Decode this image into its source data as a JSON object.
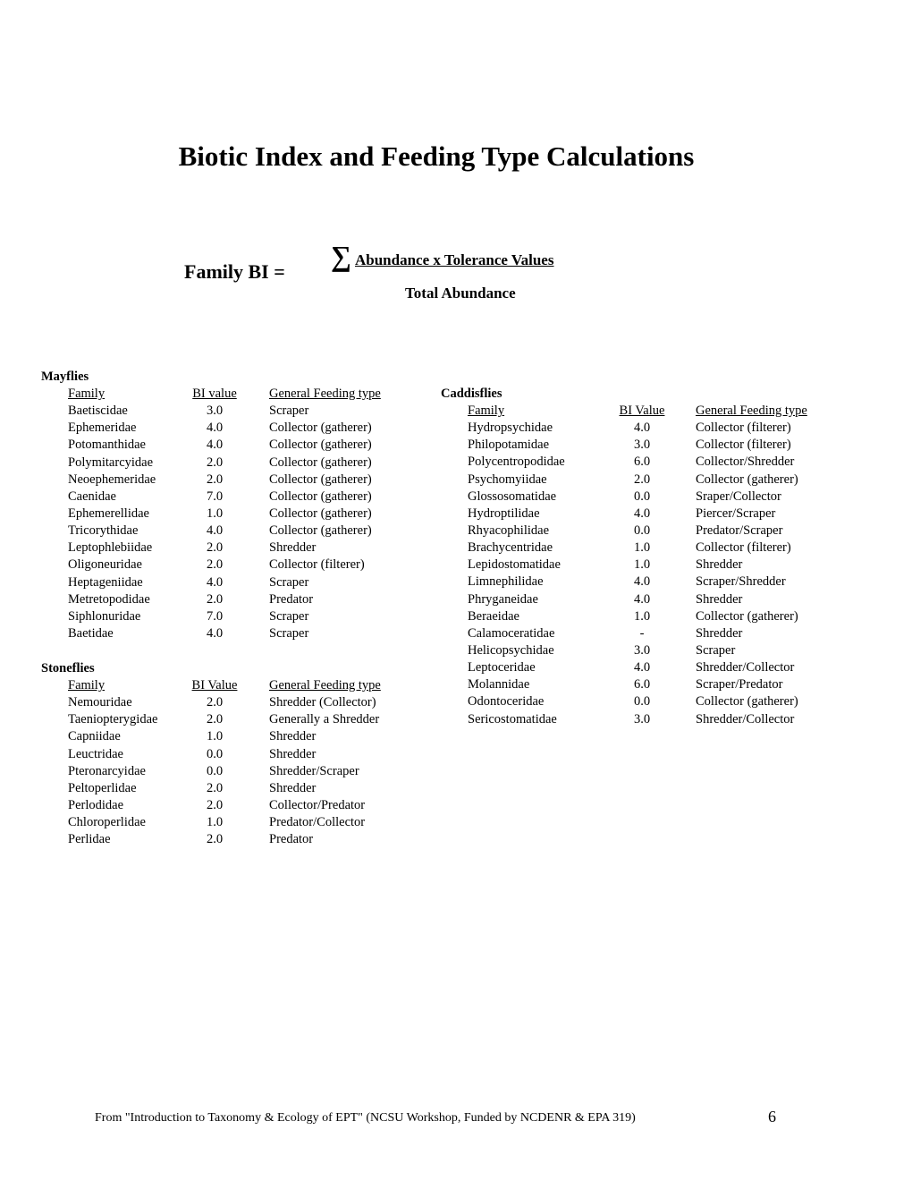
{
  "title": "Biotic Index and Feeding Type Calculations",
  "formula": {
    "label": "Family BI =",
    "sigma_icon": "∑",
    "numerator": "Abundance x Tolerance Values",
    "denominator": "Total Abundance"
  },
  "mayflies": {
    "heading": "Mayflies",
    "columns": [
      "Family",
      "BI value",
      "General Feeding type"
    ],
    "rows": [
      [
        "Baetiscidae",
        "3.0",
        "Scraper"
      ],
      [
        "Ephemeridae",
        "4.0",
        "Collector (gatherer)"
      ],
      [
        "Potomanthidae",
        "4.0",
        "Collector (gatherer)"
      ],
      [
        "Polymitarcyidae",
        "2.0",
        "Collector (gatherer)"
      ],
      [
        "Neoephemeridae",
        "2.0",
        "Collector (gatherer)"
      ],
      [
        "Caenidae",
        "7.0",
        "Collector (gatherer)"
      ],
      [
        "Ephemerellidae",
        "1.0",
        "Collector (gatherer)"
      ],
      [
        "Tricorythidae",
        "4.0",
        "Collector (gatherer)"
      ],
      [
        "Leptophlebiidae",
        "2.0",
        "Shredder"
      ],
      [
        "Oligoneuridae",
        "2.0",
        "Collector (filterer)"
      ],
      [
        "Heptageniidae",
        "4.0",
        "Scraper"
      ],
      [
        "Metretopodidae",
        "2.0",
        "Predator"
      ],
      [
        "Siphlonuridae",
        "7.0",
        "Scraper"
      ],
      [
        "Baetidae",
        "4.0",
        "Scraper"
      ]
    ]
  },
  "stoneflies": {
    "heading": "Stoneflies",
    "columns": [
      "Family",
      "BI Value",
      "General Feeding type"
    ],
    "rows": [
      [
        "Nemouridae",
        "2.0",
        "Shredder (Collector)"
      ],
      [
        "Taeniopterygidae",
        "2.0",
        "Generally a Shredder"
      ],
      [
        "Capniidae",
        "1.0",
        "Shredder"
      ],
      [
        "Leuctridae",
        "0.0",
        "Shredder"
      ],
      [
        "Pteronarcyidae",
        "0.0",
        "Shredder/Scraper"
      ],
      [
        "Peltoperlidae",
        "2.0",
        "Shredder"
      ],
      [
        "Perlodidae",
        "2.0",
        "Collector/Predator"
      ],
      [
        "Chloroperlidae",
        "1.0",
        "Predator/Collector"
      ],
      [
        "Perlidae",
        "2.0",
        "Predator"
      ]
    ]
  },
  "caddisflies": {
    "heading": "Caddisflies",
    "columns": [
      "Family",
      "BI Value",
      "General Feeding type"
    ],
    "rows": [
      [
        "Hydropsychidae",
        "4.0",
        "Collector (filterer)"
      ],
      [
        "Philopotamidae",
        "3.0",
        "Collector (filterer)"
      ],
      [
        "Polycentropodidae",
        "6.0",
        "Collector/Shredder"
      ],
      [
        "Psychomyiidae",
        "2.0",
        "Collector (gatherer)"
      ],
      [
        "Glossosomatidae",
        "0.0",
        "Sraper/Collector"
      ],
      [
        "Hydroptilidae",
        "4.0",
        "Piercer/Scraper"
      ],
      [
        "Rhyacophilidae",
        "0.0",
        "Predator/Scraper"
      ],
      [
        "Brachycentridae",
        "1.0",
        "Collector (filterer)"
      ],
      [
        "Lepidostomatidae",
        "1.0",
        "Shredder"
      ],
      [
        "Limnephilidae",
        "4.0",
        "Scraper/Shredder"
      ],
      [
        "Phryganeidae",
        "4.0",
        "Shredder"
      ],
      [
        "Beraeidae",
        "1.0",
        "Collector (gatherer)"
      ],
      [
        "Calamoceratidae",
        "-",
        "Shredder"
      ],
      [
        "Helicopsychidae",
        "3.0",
        "Scraper"
      ],
      [
        "Leptoceridae",
        "4.0",
        "Shredder/Collector"
      ],
      [
        "Molannidae",
        "6.0",
        "Scraper/Predator"
      ],
      [
        "Odontoceridae",
        "0.0",
        "Collector (gatherer)"
      ],
      [
        "Sericostomatidae",
        "3.0",
        "Shredder/Collector"
      ]
    ]
  },
  "footer": {
    "citation": "From  \"Introduction to Taxonomy & Ecology of EPT\" (NCSU Workshop, Funded by NCDENR & EPA 319)",
    "page_number": "6"
  }
}
